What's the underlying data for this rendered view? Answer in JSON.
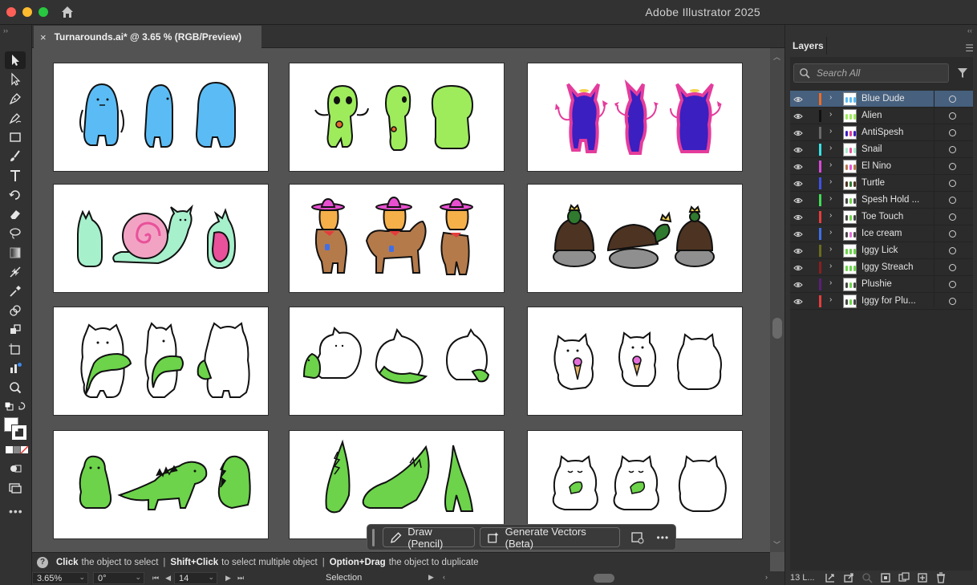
{
  "app": {
    "title": "Adobe Illustrator 2025"
  },
  "document": {
    "tab_title": "Turnarounds.ai* @ 3.65 % (RGB/Preview)"
  },
  "tools": [
    {
      "name": "selection-tool",
      "active": true
    },
    {
      "name": "direct-selection-tool"
    },
    {
      "name": "pen-tool"
    },
    {
      "name": "curvature-tool"
    },
    {
      "name": "rectangle-tool"
    },
    {
      "name": "paintbrush-tool"
    },
    {
      "name": "type-tool"
    },
    {
      "name": "rotate-tool"
    },
    {
      "name": "eraser-tool"
    },
    {
      "name": "lasso-tool"
    },
    {
      "name": "gradient-tool"
    },
    {
      "name": "width-tool"
    },
    {
      "name": "eyedropper-tool"
    },
    {
      "name": "shape-builder-tool"
    },
    {
      "name": "live-paint-tool"
    },
    {
      "name": "artboard-tool"
    },
    {
      "name": "graph-tool"
    },
    {
      "name": "zoom-tool"
    }
  ],
  "context_bar": {
    "draw_label": "Draw (Pencil)",
    "generate_label": "Generate Vectors (Beta)",
    "more_label": "•••"
  },
  "hint": {
    "q": "?",
    "click": "Click",
    "click_text": "the object to select",
    "sep": "|",
    "shift_click": "Shift+Click",
    "shift_text": "to select multiple object",
    "option_drag": "Option+Drag",
    "option_text": "the object to duplicate"
  },
  "status": {
    "zoom": "3.65%",
    "rotation": "0°",
    "artboard": "14",
    "mode": "Selection"
  },
  "layers_panel": {
    "tab_label": "Layers",
    "search_placeholder": "Search All",
    "count_label": "13 L...",
    "layers": [
      {
        "name": "Blue Dude",
        "color": "#f26b21",
        "selected": true,
        "t1": "#5bbcf5",
        "t2": "#5bbcf5"
      },
      {
        "name": "Alien",
        "color": "#111111",
        "t1": "#9eec5c",
        "t2": "#9eec5c"
      },
      {
        "name": "AntiSpesh",
        "color": "#6a6a6a",
        "t1": "#3b1fc0",
        "t2": "#e43c9c"
      },
      {
        "name": "Snail",
        "color": "#37e3e3",
        "t1": "#a6f0cc",
        "t2": "#e9519a"
      },
      {
        "name": "El Nino",
        "color": "#d94ad9",
        "t1": "#b57a4a",
        "t2": "#e84fd0"
      },
      {
        "name": "Turtle",
        "color": "#3e52e8",
        "t1": "#4d3322",
        "t2": "#2f7a2f"
      },
      {
        "name": "Spesh Hold ...",
        "color": "#3fdb53",
        "t1": "#444444",
        "t2": "#6cd34a"
      },
      {
        "name": "Toe Touch",
        "color": "#e83c3c",
        "t1": "#444444",
        "t2": "#6cd34a"
      },
      {
        "name": "Ice cream",
        "color": "#3f6fe8",
        "t1": "#444444",
        "t2": "#e36ed8"
      },
      {
        "name": "Iggy Lick",
        "color": "#6b6b1f",
        "t1": "#6cd34a",
        "t2": "#6cd34a"
      },
      {
        "name": "Iggy Streach",
        "color": "#8a1f1f",
        "t1": "#6cd34a",
        "t2": "#6cd34a"
      },
      {
        "name": "Plushie",
        "color": "#5a1f7a",
        "t1": "#444444",
        "t2": "#6cd34a"
      },
      {
        "name": "Iggy for Plu...",
        "color": "#e83c3c",
        "t1": "#444444",
        "t2": "#6cd34a"
      }
    ]
  },
  "artboards": [
    {
      "name": "Blue Dude"
    },
    {
      "name": "Alien"
    },
    {
      "name": "AntiSpesh"
    },
    {
      "name": "Snail"
    },
    {
      "name": "El Nino"
    },
    {
      "name": "Turtle"
    },
    {
      "name": "Spesh Hold"
    },
    {
      "name": "Toe Touch"
    },
    {
      "name": "Ice cream"
    },
    {
      "name": "Iggy Lick"
    },
    {
      "name": "Iggy Streach"
    },
    {
      "name": "Plushie"
    }
  ]
}
